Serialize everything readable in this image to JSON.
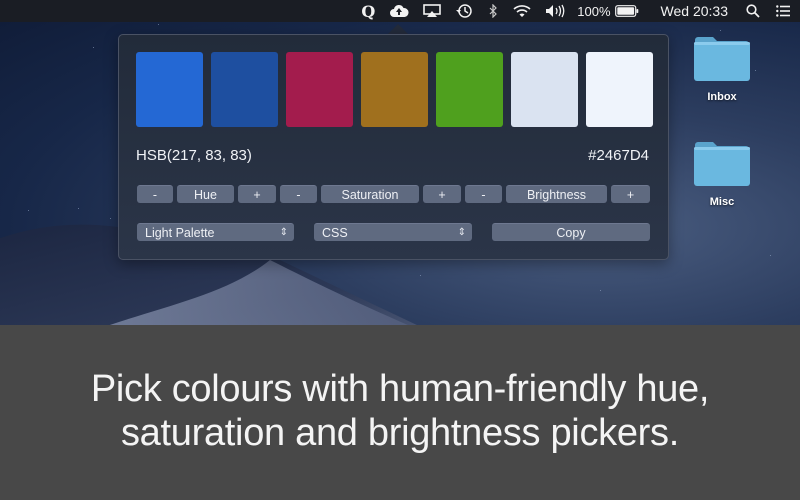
{
  "menubar": {
    "app_icon": "Q",
    "icons": [
      "app-q-icon",
      "cloud-upload-icon",
      "airplay-icon",
      "time-machine-icon",
      "bluetooth-icon",
      "wifi-icon",
      "volume-icon"
    ],
    "battery_percent": "100%",
    "clock": "Wed 20:33",
    "right_icons": [
      "search-icon",
      "notification-center-icon"
    ]
  },
  "popover": {
    "swatches": [
      {
        "color": "#2468D4",
        "name": "blue"
      },
      {
        "color": "#1E4FA0",
        "name": "dark-blue"
      },
      {
        "color": "#A31C4D",
        "name": "crimson"
      },
      {
        "color": "#A0701E",
        "name": "ochre"
      },
      {
        "color": "#4FA01E",
        "name": "green"
      },
      {
        "color": "#DAE3F1",
        "name": "pale-blue"
      },
      {
        "color": "#EFF4FC",
        "name": "near-white"
      }
    ],
    "hsb": "HSB(217, 83, 83)",
    "hex": "#2467D4",
    "controls": {
      "hue_minus": "-",
      "hue_label": "Hue",
      "hue_plus": "+",
      "sat_minus": "-",
      "sat_label": "Saturation",
      "sat_plus": "+",
      "bri_minus": "-",
      "bri_label": "Brightness",
      "bri_plus": "+"
    },
    "palette_select": "Light Palette",
    "format_select": "CSS",
    "copy_label": "Copy"
  },
  "desktop": {
    "folders": [
      {
        "label": "Inbox"
      },
      {
        "label": "Misc"
      }
    ]
  },
  "caption": {
    "line1": "Pick colours with human-friendly hue,",
    "line2": "saturation and brightness pickers."
  }
}
